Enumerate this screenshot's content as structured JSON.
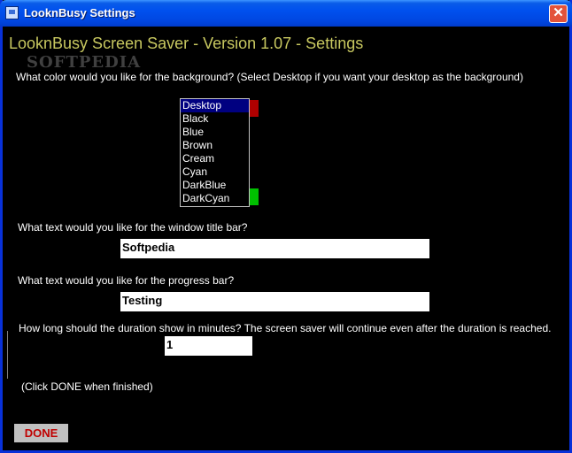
{
  "window": {
    "title": "LooknBusy Settings",
    "close_label": "✕"
  },
  "heading": "LooknBusy Screen Saver - Version 1.07  -  Settings",
  "watermark": "SOFTPEDIA",
  "background": {
    "question": "What color would you like for the background? (Select Desktop if you want your desktop as the background)",
    "options": [
      "Desktop",
      "Black",
      "Blue",
      "Brown",
      "Cream",
      "Cyan",
      "DarkBlue",
      "DarkCyan"
    ],
    "selected": "Desktop",
    "swatch_colors": [
      "#b00000",
      "#00c000"
    ]
  },
  "title_bar": {
    "question": "What text would you like for the window title bar?",
    "value": "Softpedia"
  },
  "progress_bar": {
    "question": "What text would you like for the progress bar?",
    "value": "Testing"
  },
  "duration": {
    "question": "How long should the duration show in minutes?  The screen saver will continue even after the duration is reached.",
    "value": "1"
  },
  "hint": "(Click DONE when finished)",
  "done_label": "DONE"
}
